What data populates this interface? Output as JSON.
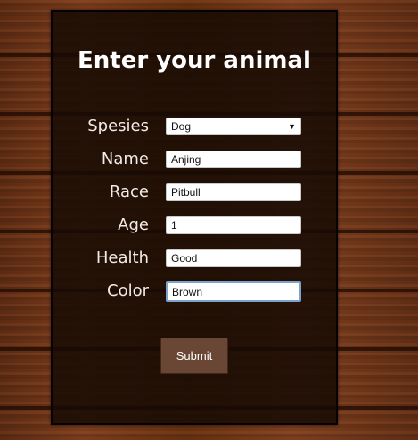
{
  "form": {
    "title": "Enter your animal",
    "species": {
      "label": "Spesies",
      "selected": "Dog"
    },
    "name": {
      "label": "Name",
      "value": "Anjing"
    },
    "race": {
      "label": "Race",
      "value": "Pitbull"
    },
    "age": {
      "label": "Age",
      "value": "1"
    },
    "health": {
      "label": "Health",
      "value": "Good"
    },
    "color": {
      "label": "Color",
      "value": "Brown"
    },
    "submit_label": "Submit"
  },
  "colors": {
    "panel_background": "#160a04",
    "submit_background": "#6a4734",
    "focus_border": "#7da2ce"
  }
}
